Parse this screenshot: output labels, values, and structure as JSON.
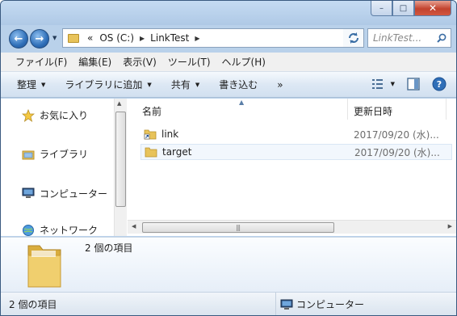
{
  "window": {
    "caption_buttons": {
      "minimize": "–",
      "maximize": "□",
      "close": "✕"
    }
  },
  "address": {
    "overflow": "«",
    "crumbs": [
      "OS (C:)",
      "LinkTest"
    ],
    "search_placeholder": "LinkTest..."
  },
  "menu": {
    "items": [
      "ファイル(F)",
      "編集(E)",
      "表示(V)",
      "ツール(T)",
      "ヘルプ(H)"
    ]
  },
  "toolbar": {
    "organize": "整理",
    "include_library": "ライブラリに追加",
    "share": "共有",
    "burn": "書き込む",
    "more": "»"
  },
  "navpane": {
    "items": [
      {
        "label": "お気に入り",
        "icon": "star-icon"
      },
      {
        "label": "ライブラリ",
        "icon": "library-icon"
      },
      {
        "label": "コンピューター",
        "icon": "computer-icon"
      },
      {
        "label": "ネットワーク",
        "icon": "network-icon"
      }
    ]
  },
  "files": {
    "columns": {
      "name": "名前",
      "date": "更新日時"
    },
    "rows": [
      {
        "name": "link",
        "date": "2017/09/20 (水)...",
        "icon": "shortcut-folder-icon"
      },
      {
        "name": "target",
        "date": "2017/09/20 (水)...",
        "icon": "folder-icon"
      }
    ]
  },
  "details": {
    "count": "2 個の項目"
  },
  "status": {
    "left": "2 個の項目",
    "right": "コンピューター"
  },
  "colors": {
    "folder": "#e8c35a",
    "selected_row": "#f2f7fd",
    "accent": "#2f6fb8"
  }
}
